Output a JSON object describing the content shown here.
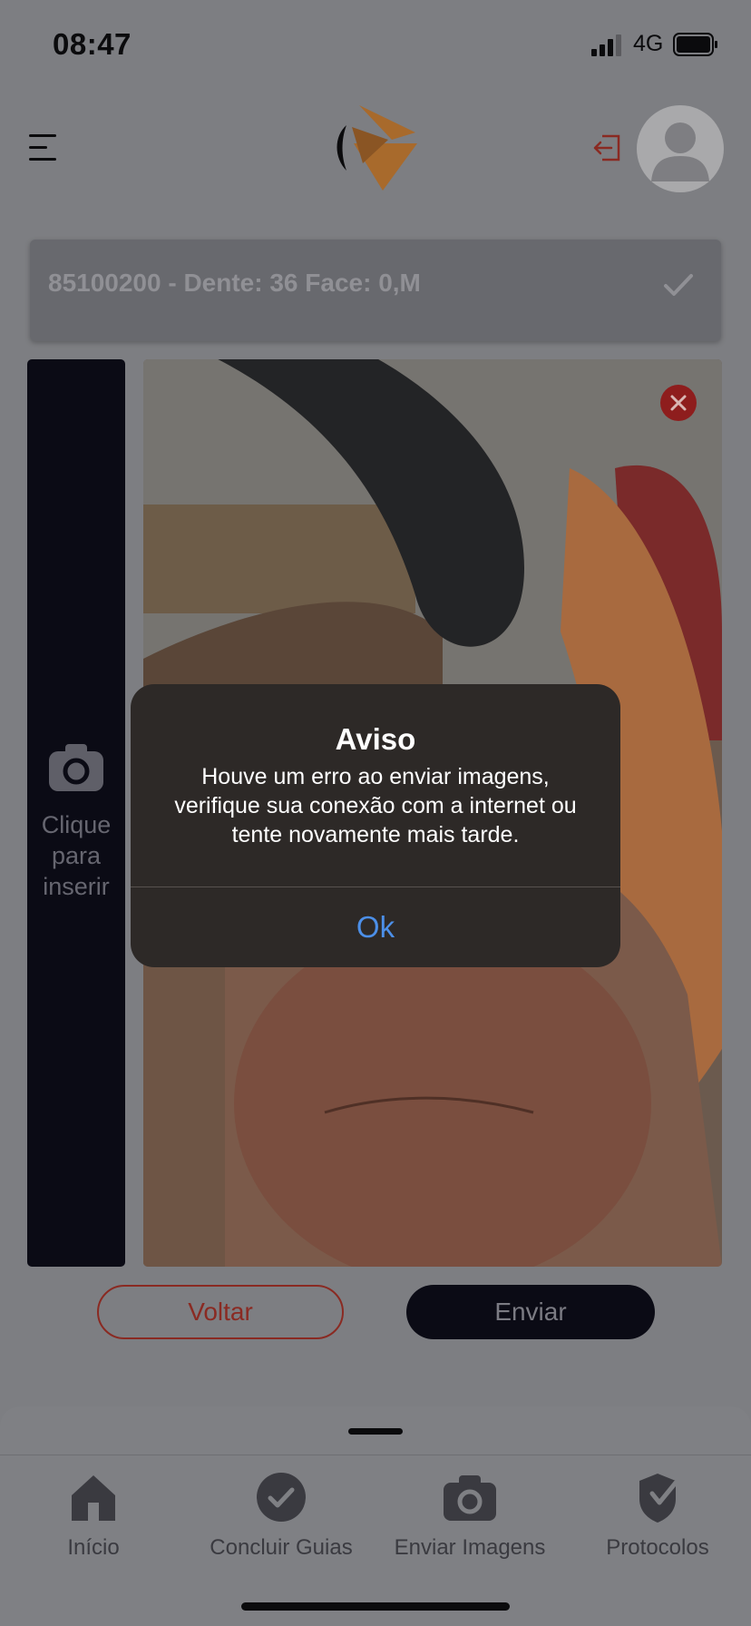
{
  "status_bar": {
    "time": "08:47",
    "network": "4G"
  },
  "procedure": {
    "label": "85100200 - Dente: 36 Face: 0,M"
  },
  "side_panel": {
    "label": "Clique para inserir"
  },
  "buttons": {
    "back": "Voltar",
    "send": "Enviar"
  },
  "alert": {
    "title": "Aviso",
    "message": "Houve um erro ao enviar imagens, verifique sua conexão com a internet ou tente novamente mais tarde.",
    "ok": "Ok"
  },
  "nav": {
    "items": [
      {
        "label": "Início",
        "icon": "home-icon"
      },
      {
        "label": "Concluir Guias",
        "icon": "check-circle-icon"
      },
      {
        "label": "Enviar Imagens",
        "icon": "camera-icon"
      },
      {
        "label": "Protocolos",
        "icon": "shield-check-icon"
      }
    ]
  },
  "colors": {
    "accent_red": "#8a2a22",
    "dark_navy": "#0b0b15",
    "alert_link": "#4c8fe8",
    "logo_orange": "#a86a2c"
  }
}
